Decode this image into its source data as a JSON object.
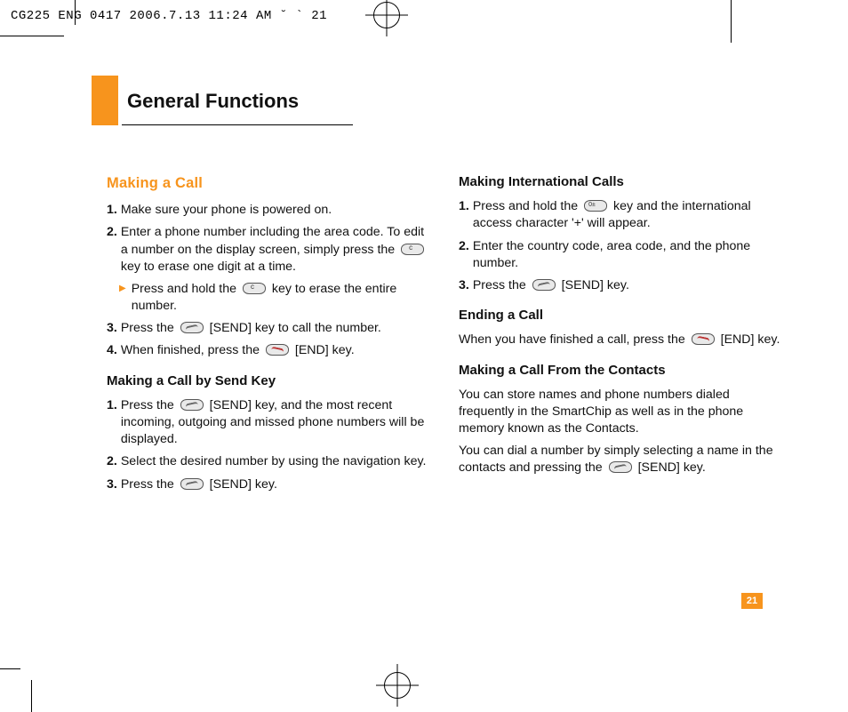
{
  "meta": {
    "header_line": "CG225 ENG 0417  2006.7.13 11:24 AM  ˘   ` 21"
  },
  "title": "General Functions",
  "page_number": "21",
  "left": {
    "heading": "Making a Call",
    "steps": {
      "n1": "1.",
      "s1": "Make sure your phone is powered on.",
      "n2": "2.",
      "s2a": "Enter a phone number including the area code. To edit a number on the display screen, simply press the ",
      "s2b": " key to erase one digit at a time.",
      "sub_a": "Press and hold the ",
      "sub_b": " key to erase the entire number.",
      "n3": "3.",
      "s3a": "Press the ",
      "s3b": " [SEND] key to call the number.",
      "n4": "4.",
      "s4a": "When finished, press the ",
      "s4b": " [END] key."
    },
    "sub_heading": "Making a Call by Send Key",
    "sendkey": {
      "n1": "1.",
      "s1a": "Press the ",
      "s1b": " [SEND] key, and the most recent incoming, outgoing and missed phone numbers will be displayed.",
      "n2": "2.",
      "s2": "Select the desired number by using the navigation key.",
      "n3": "3.",
      "s3a": "Press the ",
      "s3b": " [SEND] key."
    }
  },
  "right": {
    "heading1": "Making International Calls",
    "intl": {
      "n1": "1.",
      "s1a": "Press and hold the ",
      "s1b": " key and the international access character '+' will appear.",
      "n2": "2.",
      "s2": "Enter the country code, area code, and the phone number.",
      "n3": "3.",
      "s3a": "Press the ",
      "s3b": " [SEND] key."
    },
    "heading2": "Ending a Call",
    "end_a": "When you have finished a call, press the ",
    "end_b": " [END] key.",
    "heading3": "Making a Call From the Contacts",
    "contacts_p1": "You can store names and phone numbers dialed frequently in the SmartChip as well as in the phone memory known as the Contacts.",
    "contacts_p2a": "You can dial a number by simply selecting a name in the contacts and pressing the ",
    "contacts_p2b": " [SEND] key."
  }
}
